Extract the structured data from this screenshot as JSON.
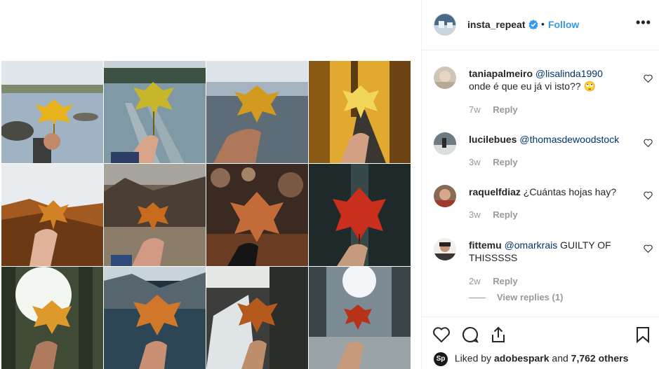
{
  "post": {
    "username": "insta_repeat",
    "dot": "•",
    "follow_label": "Follow",
    "more_label": "•••"
  },
  "grid": {
    "tiles": [
      {
        "name": "lake-rock-leaf-photo"
      },
      {
        "name": "dock-lake-leaf-photo"
      },
      {
        "name": "misty-field-leaf-photo"
      },
      {
        "name": "autumn-road-leaf-photo"
      },
      {
        "name": "mountain-view-leaf-photo"
      },
      {
        "name": "forest-valley-leaf-photo"
      },
      {
        "name": "bokeh-forest-leaf-photo"
      },
      {
        "name": "red-leaf-dark-photo"
      },
      {
        "name": "bright-forest-leaf-photo"
      },
      {
        "name": "alpine-lake-leaf-photo"
      },
      {
        "name": "waterfall-leaf-photo"
      },
      {
        "name": "snowy-forest-leaf-photo"
      }
    ]
  },
  "comments": [
    {
      "user": "taniapalmeiro",
      "mention": "@lisalinda1990",
      "text_line1": "",
      "text_line2": "onde é que eu já vi isto?? 🙄",
      "time": "7w",
      "reply": "Reply"
    },
    {
      "user": "lucilebues",
      "mention": "@thomasdewoodstock",
      "text_line1": "",
      "time": "3w",
      "reply": "Reply"
    },
    {
      "user": "raquelfdiaz",
      "mention": "",
      "text_line1": "¿Cuántas hojas hay?",
      "time": "3w",
      "reply": "Reply"
    },
    {
      "user": "fittemu",
      "mention": "@omarkrais",
      "text_line1": "GUILTY OF",
      "text_line2": "THISSSSS",
      "time": "2w",
      "reply": "Reply"
    }
  ],
  "view_replies": "View replies (1)",
  "likes": {
    "badge": "Sp",
    "prefix": "Liked by",
    "user": "adobespark",
    "and": "and",
    "count": "7,762 others"
  },
  "colors": {
    "follow_blue": "#3897f0",
    "verified_blue": "#3897f0",
    "muted_gray": "#999999",
    "mention_blue": "#003569"
  },
  "icons": [
    "verified-badge-icon",
    "more-options-icon",
    "heart-icon",
    "comment-icon",
    "share-icon",
    "bookmark-icon"
  ]
}
